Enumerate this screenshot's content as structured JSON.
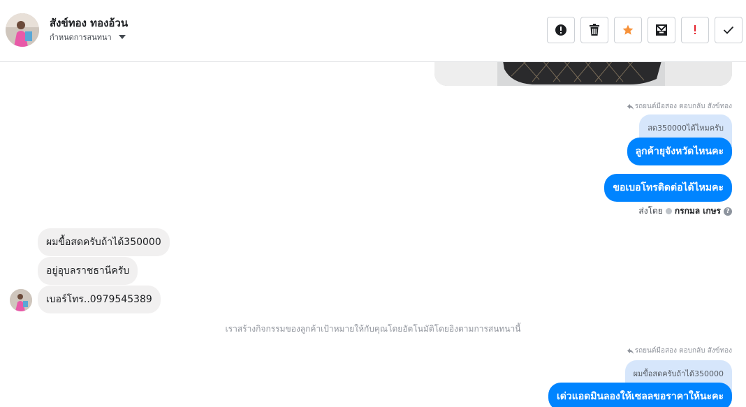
{
  "header": {
    "contact_name": "สังข์ทอง ทองอ้วน",
    "assign_label": "กำหนดการสนทนา",
    "toolbar": [
      "alert-icon",
      "trash-icon",
      "star-icon",
      "archive-icon",
      "exclamation-icon",
      "check-icon"
    ]
  },
  "colors": {
    "accent": "#0084ff",
    "star": "#f7923a",
    "alert": "#e4202a"
  },
  "messages": {
    "reply1_meta": "รถยนต์มือสอง ตอบกลับ สังข์ทอง",
    "reply1_quote": "สด350000ได้ไหมครับ",
    "reply1_text": "ลูกค้ายุจังหวัดไหนคะ",
    "out2_text": "ขอเบอโทรติดต่อได้ไหมคะ",
    "sent_by_label": "ส่งโดย",
    "sent_by_name": "กรกมล เกษร",
    "help_glyph": "?",
    "in1": "ผมขื้อสดครับถ้าได้350000",
    "in2": "อยู่อุบลราชธานีครับ",
    "in3": "เบอร์โทร..0979545389",
    "system_note": "เราสร้างกิจกรรมของลูกค้าเป้าหมายให้กับคุณโดยอัตโนมัติโดยอิงตามการสนทนานี้",
    "reply2_meta": "รถยนต์มือสอง ตอบกลับ สังข์ทอง",
    "reply2_quote": "ผมขื้อสดครับถ้าได้350000",
    "reply2_text": "เด่วแอดมินลองให้เซลลขอราคาให้นะคะ"
  }
}
